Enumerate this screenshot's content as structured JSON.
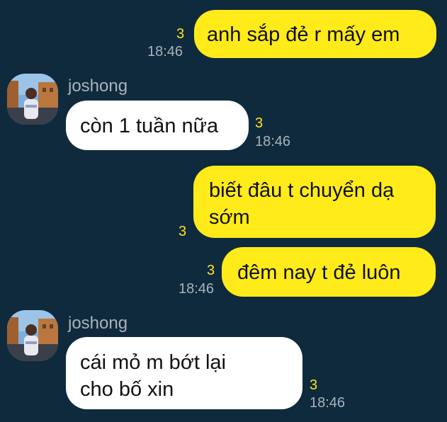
{
  "theme": {
    "background": "#0f2a3d",
    "outgoing_bubble": "#ffeb1a",
    "incoming_bubble": "#ffffff",
    "unread_color": "#ffe21a",
    "meta_text": "#a9b3ba"
  },
  "messages": [
    {
      "direction": "outgoing",
      "text": "anh sắp đẻ r mấy em",
      "unread": "3",
      "time": "18:46"
    },
    {
      "direction": "incoming",
      "sender": "joshong",
      "text": "còn 1 tuần nữa",
      "unread": "3",
      "time": "18:46",
      "avatar_icon": "profile-photo"
    },
    {
      "direction": "outgoing",
      "text": "biết đâu t chuyển dạ\nsớm",
      "unread": "3",
      "time": ""
    },
    {
      "direction": "outgoing",
      "text": "đêm nay t đẻ luôn",
      "unread": "3",
      "time": "18:46"
    },
    {
      "direction": "incoming",
      "sender": "joshong",
      "text": "cái mỏ m bớt lại\ncho bố xin",
      "unread": "3",
      "time": "18:46",
      "avatar_icon": "profile-photo"
    }
  ]
}
